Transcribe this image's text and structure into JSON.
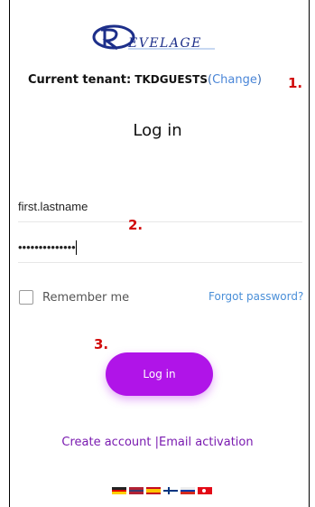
{
  "brand": {
    "logo_text": "EVELAGE"
  },
  "tenant": {
    "label": "Current tenant:",
    "name": "TKDGUESTS",
    "paren_open": "(",
    "change_label": "Change",
    "paren_close": ")"
  },
  "annotations": {
    "one": "1.",
    "two": "2.",
    "three": "3."
  },
  "form": {
    "title": "Log in",
    "username_value": "first.lastname",
    "password_value": "••••••••••••••",
    "remember_label": "Remember me",
    "forgot_label": "Forgot password?",
    "submit_label": "Log in"
  },
  "footer": {
    "create_account": "Create account",
    "separator": "|",
    "email_activation": "Email activation"
  },
  "languages": [
    "german-flag",
    "us-flag",
    "spanish-flag",
    "finnish-flag",
    "russian-flag",
    "turkish-flag"
  ],
  "colors": {
    "accent": "#b014e8",
    "link": "#4a86d8",
    "footer_link": "#7a1bb0",
    "annotation": "#d10c0c"
  }
}
